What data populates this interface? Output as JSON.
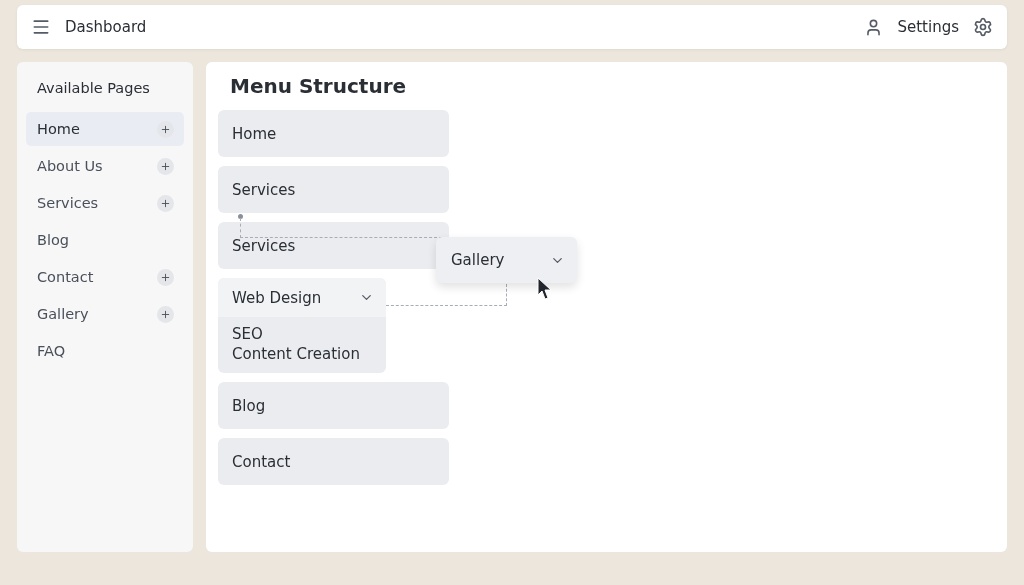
{
  "topbar": {
    "title": "Dashboard",
    "settings_label": "Settings"
  },
  "sidebar": {
    "title": "Available Pages",
    "items": [
      {
        "label": "Home",
        "selected": true,
        "addable": true
      },
      {
        "label": "About Us",
        "selected": false,
        "addable": true
      },
      {
        "label": "Services",
        "selected": false,
        "addable": true
      },
      {
        "label": "Blog",
        "selected": false,
        "addable": false
      },
      {
        "label": "Contact",
        "selected": false,
        "addable": true
      },
      {
        "label": "Gallery",
        "selected": false,
        "addable": true
      },
      {
        "label": "FAQ",
        "selected": false,
        "addable": false
      }
    ]
  },
  "menu": {
    "title": "Menu Structure",
    "items": [
      {
        "kind": "item",
        "label": "Home"
      },
      {
        "kind": "item",
        "label": "Services"
      },
      {
        "kind": "item",
        "label": "Services"
      },
      {
        "kind": "group",
        "label": "Web Design",
        "expanded": true,
        "children": [
          {
            "label": "SEO"
          },
          {
            "label": "Content Creation"
          }
        ]
      },
      {
        "kind": "item",
        "label": "Blog"
      },
      {
        "kind": "item",
        "label": "Contact"
      }
    ],
    "dragging": {
      "label": "Gallery"
    }
  }
}
